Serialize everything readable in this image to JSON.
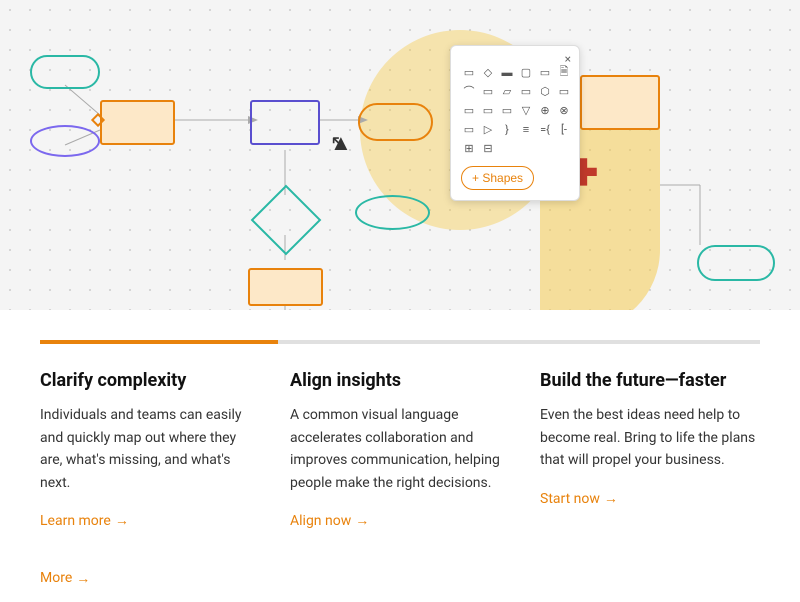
{
  "diagram": {
    "shapes_panel_close": "×",
    "shapes_button_label": "+ Shapes"
  },
  "progress": {
    "filled_percent": 33
  },
  "sections": [
    {
      "id": "clarify",
      "heading": "Clarify complexity",
      "body": "Individuals and teams can easily and quickly map out where they are, what's missing, and what's next.",
      "link_label": "Learn more",
      "link_arrow": "→"
    },
    {
      "id": "align",
      "heading": "Align insights",
      "body": "A common visual language accelerates collaboration and improves communication, helping people make the right decisions.",
      "link_label": "Align now",
      "link_arrow": "→"
    },
    {
      "id": "build",
      "heading": "Build the future—faster",
      "body": "Even the best ideas need help to become real. Bring to life the plans that will propel your business.",
      "link_label": "Start now",
      "link_arrow": "→"
    }
  ],
  "more": {
    "label": "More",
    "arrow": "→"
  },
  "colors": {
    "orange": "#e8820c",
    "teal": "#2ab8a5",
    "purple": "#5a4fcf",
    "lavender": "#7b68ee",
    "red": "#c0392b"
  }
}
